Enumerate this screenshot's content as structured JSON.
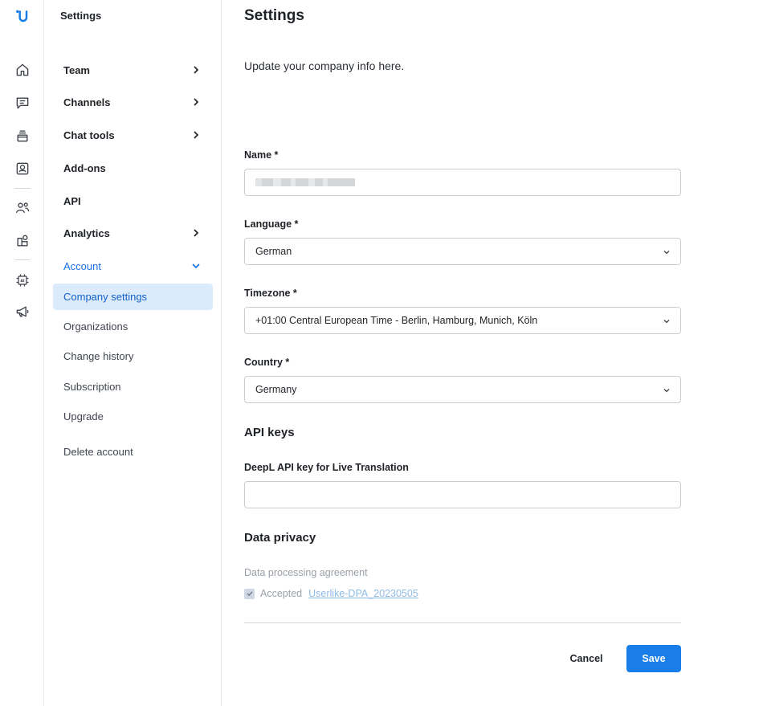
{
  "brand": {
    "logo_icon": "userlike-u-logo",
    "accent": "#1a7ee8"
  },
  "rail": {
    "items": [
      {
        "icon": "home-icon"
      },
      {
        "icon": "chat-icon"
      },
      {
        "icon": "inbox-icon"
      },
      {
        "icon": "contacts-icon"
      },
      {
        "icon": "team-icon"
      },
      {
        "icon": "integrations-icon"
      },
      {
        "icon": "ai-chip-icon"
      },
      {
        "icon": "megaphone-icon"
      }
    ]
  },
  "sidebar": {
    "title": "Settings",
    "items": [
      {
        "label": "Team",
        "has_chevron": true
      },
      {
        "label": "Channels",
        "has_chevron": true
      },
      {
        "label": "Chat tools",
        "has_chevron": true
      },
      {
        "label": "Add-ons",
        "has_chevron": false
      },
      {
        "label": "API",
        "has_chevron": false
      },
      {
        "label": "Analytics",
        "has_chevron": true
      },
      {
        "label": "Account",
        "expanded": true
      }
    ],
    "sub_items": [
      {
        "label": "Company settings",
        "active": true
      },
      {
        "label": "Organizations"
      },
      {
        "label": "Change history"
      },
      {
        "label": "Subscription"
      },
      {
        "label": "Upgrade"
      },
      {
        "label": "Delete account"
      }
    ]
  },
  "main": {
    "title": "Settings",
    "subtitle": "Update your company info here.",
    "fields": {
      "name": {
        "label": "Name *",
        "value_redacted": true
      },
      "language": {
        "label": "Language *",
        "value": "German"
      },
      "timezone": {
        "label": "Timezone *",
        "value": "+01:00 Central European Time - Berlin, Hamburg, Munich, Köln"
      },
      "country": {
        "label": "Country *",
        "value": "Germany"
      }
    },
    "api_keys": {
      "title": "API keys",
      "deepl_label": "DeepL API key for Live Translation",
      "deepl_value": ""
    },
    "privacy": {
      "title": "Data privacy",
      "agreement_label": "Data processing agreement",
      "accepted_label": "Accepted",
      "accepted": true,
      "dpa_link": "Userlike-DPA_20230505"
    },
    "actions": {
      "cancel": "Cancel",
      "save": "Save"
    }
  }
}
